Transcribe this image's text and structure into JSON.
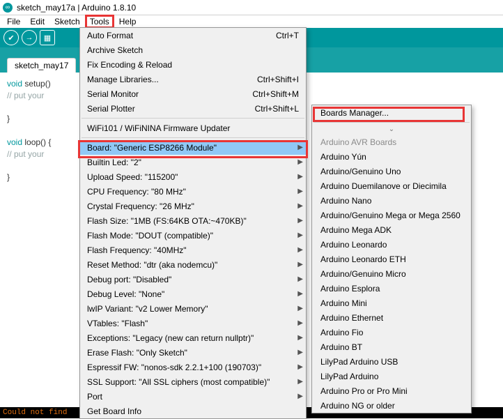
{
  "window": {
    "title": "sketch_may17a | Arduino 1.8.10"
  },
  "menubar": {
    "items": [
      "File",
      "Edit",
      "Sketch",
      "Tools",
      "Help"
    ],
    "highlighted_index": 3
  },
  "tab": {
    "label": "sketch_may17"
  },
  "code": {
    "line1_kw": "void",
    "line1_rest": " setup()",
    "line2": "  // put your",
    "line3": "}",
    "line4_kw": "void",
    "line4_rest": " loop() {",
    "line5": "  // put your",
    "line6": "}"
  },
  "tools_menu": {
    "group1": [
      {
        "label": "Auto Format",
        "shortcut": "Ctrl+T",
        "sub": false
      },
      {
        "label": "Archive Sketch",
        "shortcut": "",
        "sub": false
      },
      {
        "label": "Fix Encoding & Reload",
        "shortcut": "",
        "sub": false
      },
      {
        "label": "Manage Libraries...",
        "shortcut": "Ctrl+Shift+I",
        "sub": false
      },
      {
        "label": "Serial Monitor",
        "shortcut": "Ctrl+Shift+M",
        "sub": false
      },
      {
        "label": "Serial Plotter",
        "shortcut": "Ctrl+Shift+L",
        "sub": false
      }
    ],
    "group2": [
      {
        "label": "WiFi101 / WiFiNINA Firmware Updater",
        "shortcut": "",
        "sub": false
      }
    ],
    "group3": [
      {
        "label": "Board: \"Generic ESP8266 Module\"",
        "sub": true,
        "hl": true
      },
      {
        "label": "Builtin Led: \"2\"",
        "sub": true
      },
      {
        "label": "Upload Speed: \"115200\"",
        "sub": true
      },
      {
        "label": "CPU Frequency: \"80 MHz\"",
        "sub": true
      },
      {
        "label": "Crystal Frequency: \"26 MHz\"",
        "sub": true
      },
      {
        "label": "Flash Size: \"1MB (FS:64KB OTA:~470KB)\"",
        "sub": true
      },
      {
        "label": "Flash Mode: \"DOUT (compatible)\"",
        "sub": true
      },
      {
        "label": "Flash Frequency: \"40MHz\"",
        "sub": true
      },
      {
        "label": "Reset Method: \"dtr (aka nodemcu)\"",
        "sub": true
      },
      {
        "label": "Debug port: \"Disabled\"",
        "sub": true
      },
      {
        "label": "Debug Level: \"None\"",
        "sub": true
      },
      {
        "label": "lwIP Variant: \"v2 Lower Memory\"",
        "sub": true
      },
      {
        "label": "VTables: \"Flash\"",
        "sub": true
      },
      {
        "label": "Exceptions: \"Legacy (new can return nullptr)\"",
        "sub": true
      },
      {
        "label": "Erase Flash: \"Only Sketch\"",
        "sub": true
      },
      {
        "label": "Espressif FW: \"nonos-sdk 2.2.1+100 (190703)\"",
        "sub": true
      },
      {
        "label": "SSL Support: \"All SSL ciphers (most compatible)\"",
        "sub": true
      },
      {
        "label": "Port",
        "sub": true
      },
      {
        "label": "Get Board Info",
        "sub": false
      }
    ]
  },
  "boards_submenu": {
    "top": "Boards Manager...",
    "header": "Arduino AVR Boards",
    "items": [
      "Arduino Yún",
      "Arduino/Genuino Uno",
      "Arduino Duemilanove or Diecimila",
      "Arduino Nano",
      "Arduino/Genuino Mega or Mega 2560",
      "Arduino Mega ADK",
      "Arduino Leonardo",
      "Arduino Leonardo ETH",
      "Arduino/Genuino Micro",
      "Arduino Esplora",
      "Arduino Mini",
      "Arduino Ethernet",
      "Arduino Fio",
      "Arduino BT",
      "LilyPad Arduino USB",
      "LilyPad Arduino",
      "Arduino Pro or Pro Mini",
      "Arduino NG or older"
    ]
  },
  "status": {
    "text": "Could not find"
  }
}
